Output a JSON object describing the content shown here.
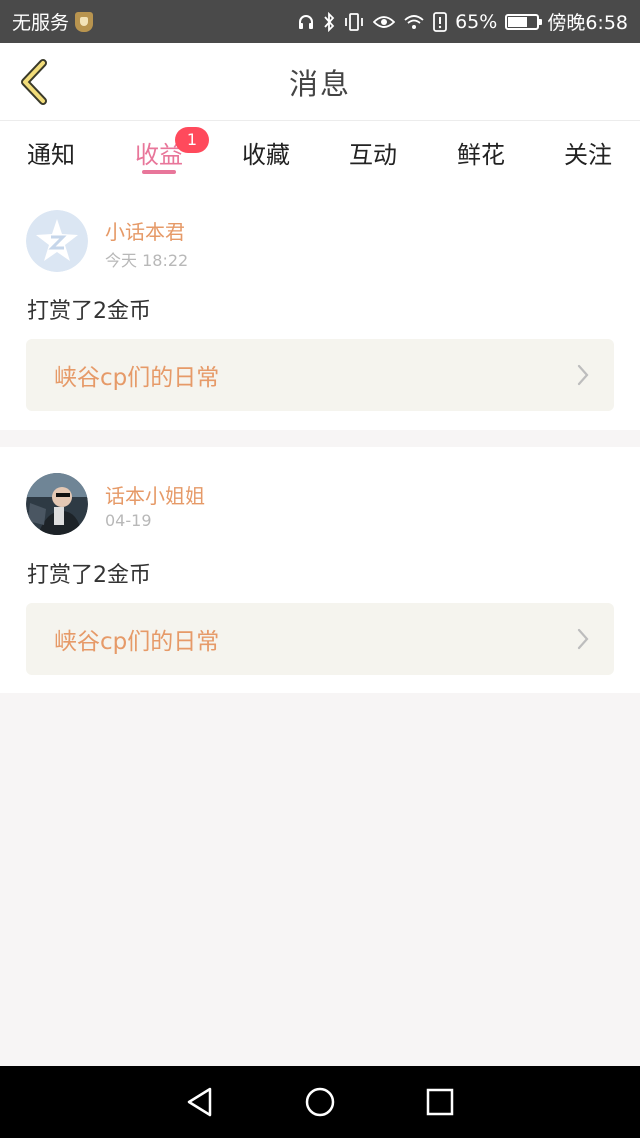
{
  "status_bar": {
    "carrier": "无服务",
    "battery_percent": "65%",
    "battery_level": 0.65,
    "time": "傍晚6:58"
  },
  "header": {
    "title": "消息"
  },
  "tabs": [
    {
      "label": "通知"
    },
    {
      "label": "收益",
      "badge": "1",
      "active": true
    },
    {
      "label": "收藏"
    },
    {
      "label": "互动"
    },
    {
      "label": "鲜花"
    },
    {
      "label": "关注"
    }
  ],
  "items": [
    {
      "username": "小话本君",
      "time": "今天 18:22",
      "message": "打赏了2金币",
      "link": "峡谷cp们的日常"
    },
    {
      "username": "话本小姐姐",
      "time": "04-19",
      "message": "打赏了2金币",
      "link": "峡谷cp们的日常"
    }
  ],
  "colors": {
    "accent": "#e8769a",
    "username": "#e69a68",
    "badge": "#ff4a5c"
  }
}
